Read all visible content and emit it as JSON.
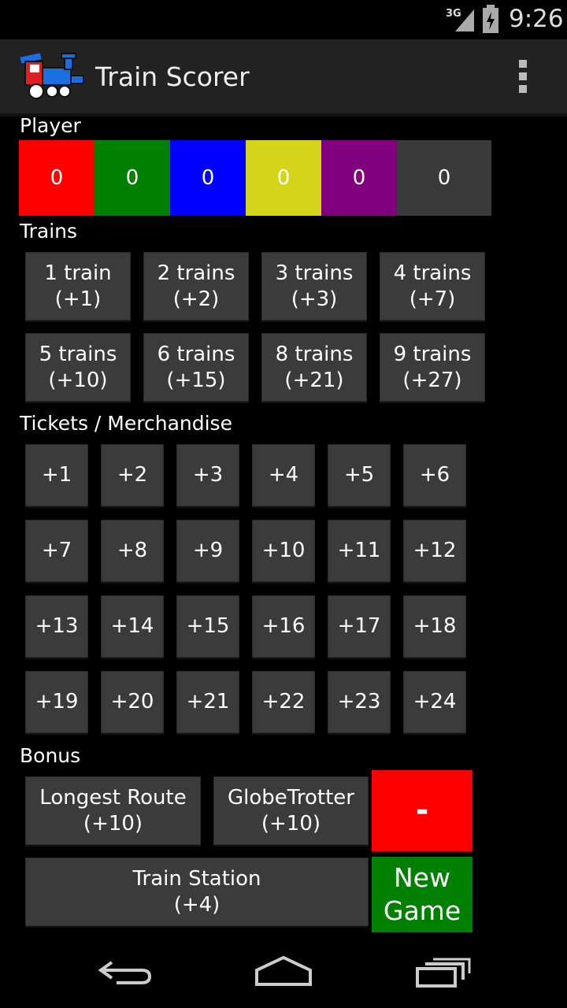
{
  "status": {
    "network": "3G",
    "time": "9:26"
  },
  "app": {
    "title": "Train Scorer"
  },
  "sections": {
    "player": "Player",
    "trains": "Trains",
    "tickets": "Tickets / Merchandise",
    "bonus": "Bonus"
  },
  "players": [
    {
      "score": "0",
      "color": "#ff0000"
    },
    {
      "score": "0",
      "color": "#008000"
    },
    {
      "score": "0",
      "color": "#0000ff"
    },
    {
      "score": "0",
      "color": "#d4d41a"
    },
    {
      "score": "0",
      "color": "#800080"
    },
    {
      "score": "0",
      "color": "#3a3a3a"
    }
  ],
  "trains": [
    {
      "l1": "1 train",
      "l2": "(+1)"
    },
    {
      "l1": "2 trains",
      "l2": "(+2)"
    },
    {
      "l1": "3 trains",
      "l2": "(+3)"
    },
    {
      "l1": "4 trains",
      "l2": "(+7)"
    },
    {
      "l1": "5 trains",
      "l2": "(+10)"
    },
    {
      "l1": "6 trains",
      "l2": "(+15)"
    },
    {
      "l1": "8 trains",
      "l2": "(+21)"
    },
    {
      "l1": "9 trains",
      "l2": "(+27)"
    }
  ],
  "tickets": [
    "+1",
    "+2",
    "+3",
    "+4",
    "+5",
    "+6",
    "+7",
    "+8",
    "+9",
    "+10",
    "+11",
    "+12",
    "+13",
    "+14",
    "+15",
    "+16",
    "+17",
    "+18",
    "+19",
    "+20",
    "+21",
    "+22",
    "+23",
    "+24"
  ],
  "bonus": {
    "longest": {
      "l1": "Longest Route",
      "l2": "(+10)"
    },
    "globe": {
      "l1": "GlobeTrotter",
      "l2": "(+10)"
    },
    "station": {
      "l1": "Train Station",
      "l2": "(+4)"
    },
    "minus": "-",
    "minus_color": "#ff0000",
    "new_game": {
      "l1": "New",
      "l2": "Game"
    },
    "new_game_color": "#008000"
  }
}
